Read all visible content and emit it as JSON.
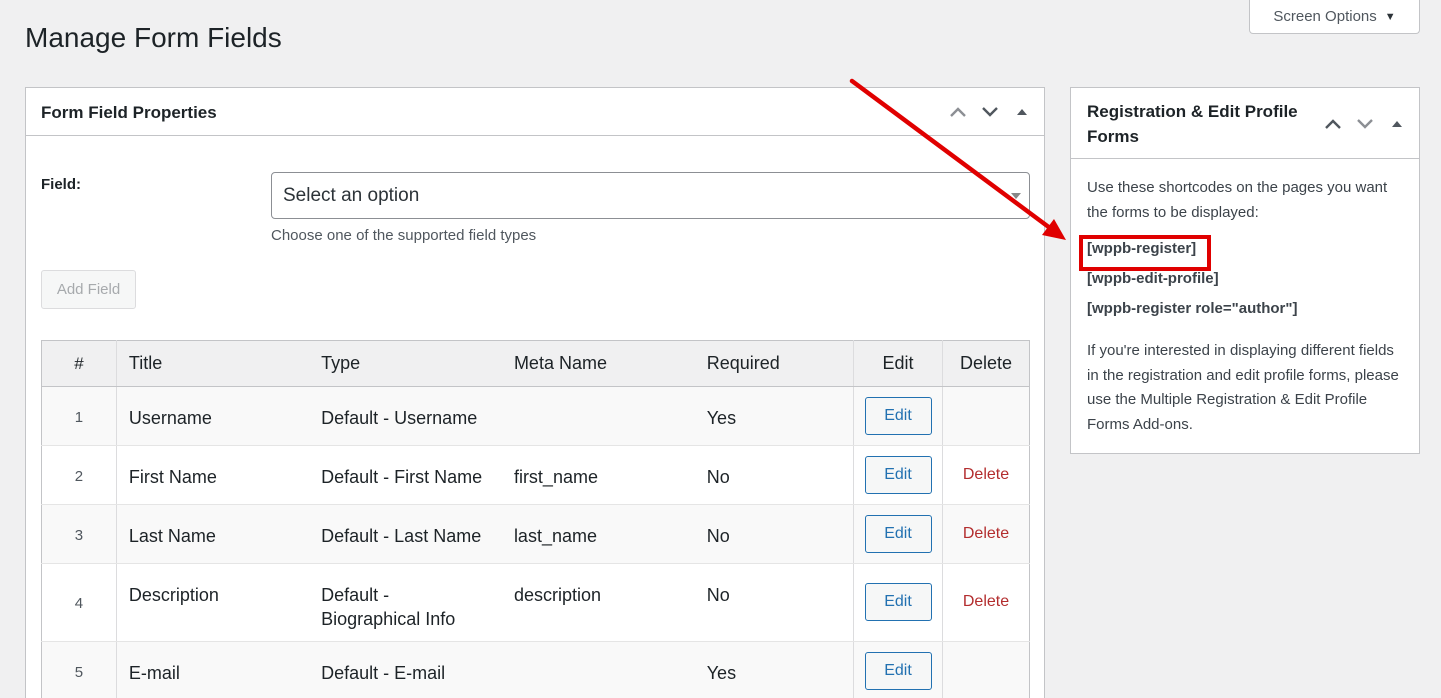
{
  "page": {
    "title": "Manage Form Fields",
    "screen_options_label": "Screen Options"
  },
  "main_box": {
    "title": "Form Field Properties",
    "field_label": "Field:",
    "select_value": "Select an option",
    "field_description": "Choose one of the supported field types",
    "add_field_label": "Add Field",
    "columns": [
      "#",
      "Title",
      "Type",
      "Meta Name",
      "Required",
      "Edit",
      "Delete"
    ],
    "rows": [
      {
        "num": "1",
        "title": "Username",
        "type": "Default - Username",
        "meta": "",
        "required": "Yes",
        "edit": "Edit",
        "delete": ""
      },
      {
        "num": "2",
        "title": "First Name",
        "type": "Default - First Name",
        "meta": "first_name",
        "required": "No",
        "edit": "Edit",
        "delete": "Delete"
      },
      {
        "num": "3",
        "title": "Last Name",
        "type": "Default - Last Name",
        "meta": "last_name",
        "required": "No",
        "edit": "Edit",
        "delete": "Delete"
      },
      {
        "num": "4",
        "title": "Description",
        "type": "Default - Biographical Info",
        "meta": "description",
        "required": "No",
        "edit": "Edit",
        "delete": "Delete"
      },
      {
        "num": "5",
        "title": "E-mail",
        "type": "Default - E-mail",
        "meta": "",
        "required": "Yes",
        "edit": "Edit",
        "delete": ""
      }
    ]
  },
  "side_box": {
    "title": "Registration & Edit Profile Forms",
    "intro": "Use these shortcodes on the pages you want the forms to be displayed:",
    "shortcodes": [
      "[wppb-register]",
      "[wppb-edit-profile]",
      "[wppb-register role=\"author\"]"
    ],
    "note": "If you're interested in displaying different fields in the registration and edit profile forms, please use the Multiple Registration & Edit Profile Forms Add-ons."
  },
  "annotation": {
    "color": "#e00000"
  },
  "icons": {
    "move_up": "chevron-up-icon",
    "move_down": "chevron-down-icon",
    "toggle": "triangle-up-icon",
    "screen_options_caret": "caret-down-icon"
  }
}
